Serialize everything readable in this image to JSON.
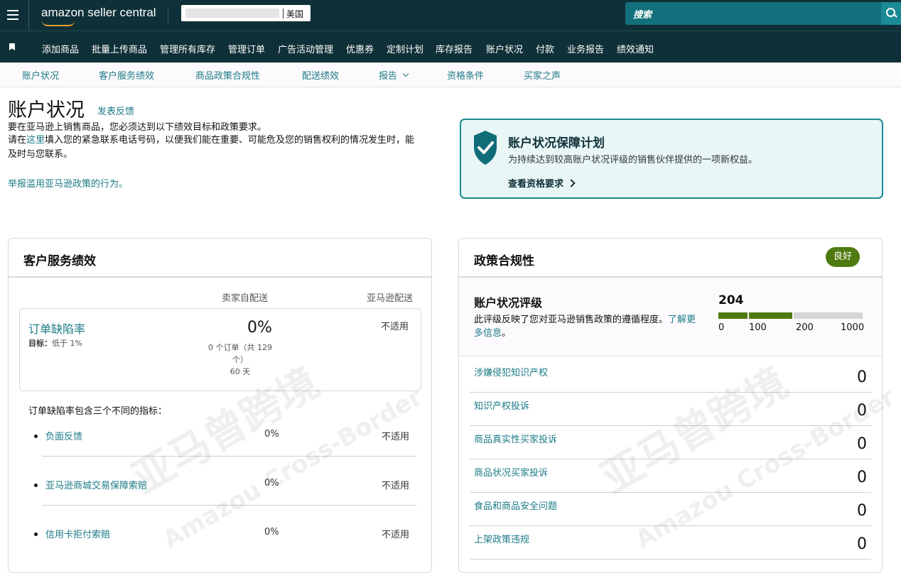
{
  "topbar": {
    "brand": "amazon seller central",
    "store_country": "美国",
    "search_placeholder": "搜索"
  },
  "nav": {
    "items": [
      "添加商品",
      "批量上传商品",
      "管理所有库存",
      "管理订单",
      "广告活动管理",
      "优惠券",
      "定制计划",
      "库存报告",
      "账户状况",
      "付款",
      "业务报告",
      "绩效通知"
    ]
  },
  "subnav": {
    "items": [
      "账户状况",
      "客户服务绩效",
      "商品政策合规性",
      "配送绩效",
      "报告",
      "资格条件",
      "买家之声"
    ]
  },
  "header": {
    "title": "账户状况",
    "feedback_link": "发表反馈",
    "intro_line1": "要在亚马逊上销售商品，您必须达到以下绩效目标和政策要求。",
    "intro_pre": "请在",
    "intro_link": "这里",
    "intro_post": "填入您的紧急联系电话号码，以便我们能在重要、可能危及您的销售权利的情况发生时，能及时与您联系。",
    "report_abuse": "举报滥用亚马逊政策的行为。"
  },
  "protection": {
    "title": "账户状况保障计划",
    "description": "为持续达到较高账户状况评级的销售伙伴提供的一项新权益。",
    "link": "查看资格要求"
  },
  "customer_service": {
    "title": "客户服务绩效",
    "col_seller": "卖家自配送",
    "col_amazon": "亚马逊配送",
    "odr": {
      "name": "订单缺陷率",
      "target_label": "目标：",
      "target_value": "低于 1%",
      "value": "0%",
      "sub_line1": "0 个订单（共 129",
      "sub_line2": "个）",
      "sub_line3": "60 天",
      "amazon_value": "不适用"
    },
    "caption": "订单缺陷率包含三个不同的指标：",
    "metrics": [
      {
        "name": "负面反馈",
        "value": "0%",
        "amazon": "不适用"
      },
      {
        "name": "亚马逊商城交易保障索赔",
        "value": "0%",
        "amazon": "不适用"
      },
      {
        "name": "信用卡拒付索赔",
        "value": "0%",
        "amazon": "不适用"
      }
    ]
  },
  "policy": {
    "title": "政策合规性",
    "badge": "良好",
    "rating_title": "账户状况评级",
    "rating_desc_pre": "此评级反映了您对亚马逊销售政策的遵循程度。",
    "rating_desc_link": "了解更多信息",
    "rating_desc_post": "。",
    "score": "204",
    "score_value": 204,
    "ticks": [
      "0",
      "100",
      "200",
      "1000"
    ],
    "rows": [
      {
        "name": "涉嫌侵犯知识产权",
        "value": "0"
      },
      {
        "name": "知识产权投诉",
        "value": "0"
      },
      {
        "name": "商品真实性买家投诉",
        "value": "0"
      },
      {
        "name": "商品状况买家投诉",
        "value": "0"
      },
      {
        "name": "食品和商品安全问题",
        "value": "0"
      },
      {
        "name": "上架政策违规",
        "value": "0"
      }
    ]
  },
  "watermark": {
    "cn": "亚马曾跨境",
    "en": "Amazou Cross-Border"
  },
  "colors": {
    "topbar": "#0f3038",
    "accent": "#1b7a86",
    "good": "#4f7a10",
    "protect_bg": "#e8f6f6"
  }
}
